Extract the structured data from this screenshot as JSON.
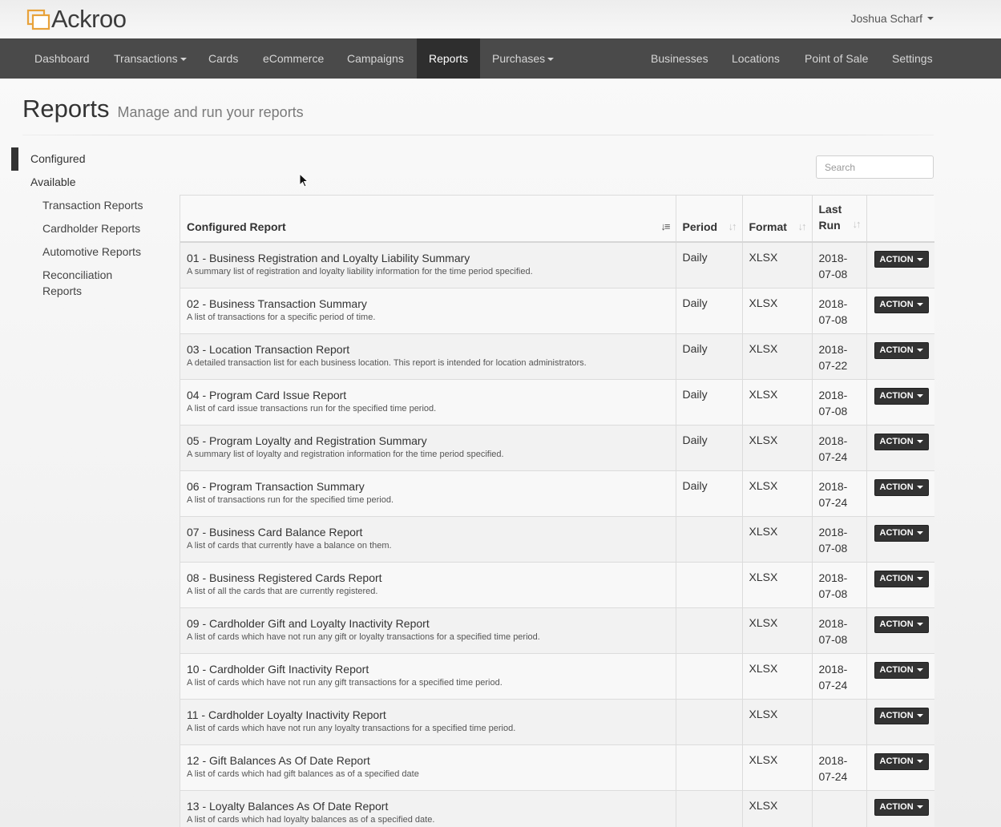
{
  "brand": {
    "name": "Ackroo"
  },
  "user": {
    "name": "Joshua Scharf"
  },
  "nav": {
    "left": [
      {
        "label": "Dashboard",
        "dropdown": false
      },
      {
        "label": "Transactions",
        "dropdown": true
      },
      {
        "label": "Cards",
        "dropdown": false
      },
      {
        "label": "eCommerce",
        "dropdown": false
      },
      {
        "label": "Campaigns",
        "dropdown": false
      },
      {
        "label": "Reports",
        "dropdown": false,
        "active": true
      },
      {
        "label": "Purchases",
        "dropdown": true
      }
    ],
    "right": [
      {
        "label": "Businesses"
      },
      {
        "label": "Locations"
      },
      {
        "label": "Point of Sale"
      },
      {
        "label": "Settings"
      }
    ]
  },
  "page": {
    "title": "Reports",
    "subtitle": "Manage and run your reports"
  },
  "sidebar": {
    "configured": "Configured",
    "available": "Available",
    "sub": [
      "Transaction Reports",
      "Cardholder Reports",
      "Automotive Reports",
      "Reconciliation",
      "Reports"
    ]
  },
  "search": {
    "placeholder": "Search"
  },
  "table": {
    "headers": {
      "report": "Configured Report",
      "period": "Period",
      "format": "Format",
      "last_run_1": "Last",
      "last_run_2": "Run"
    },
    "action_label": "ACTION",
    "rows": [
      {
        "name": "01 - Business Registration and Loyalty Liability Summary",
        "desc": "A summary list of registration and loyalty liability information for the time period specified.",
        "period": "Daily",
        "format": "XLSX",
        "last_run_1": "2018-",
        "last_run_2": "07-08"
      },
      {
        "name": "02 - Business Transaction Summary",
        "desc": "A list of transactions for a specific period of time.",
        "period": "Daily",
        "format": "XLSX",
        "last_run_1": "2018-",
        "last_run_2": "07-08"
      },
      {
        "name": "03 - Location Transaction Report",
        "desc": "A detailed transaction list for each business location. This report is intended for location administrators.",
        "period": "Daily",
        "format": "XLSX",
        "last_run_1": "2018-",
        "last_run_2": "07-22"
      },
      {
        "name": "04 - Program Card Issue Report",
        "desc": "A list of card issue transactions run for the specified time period.",
        "period": "Daily",
        "format": "XLSX",
        "last_run_1": "2018-",
        "last_run_2": "07-08"
      },
      {
        "name": "05 - Program Loyalty and Registration Summary",
        "desc": "A summary list of loyalty and registration information for the time period specified.",
        "period": "Daily",
        "format": "XLSX",
        "last_run_1": "2018-",
        "last_run_2": "07-24"
      },
      {
        "name": "06 - Program Transaction Summary",
        "desc": "A list of transactions run for the specified time period.",
        "period": "Daily",
        "format": "XLSX",
        "last_run_1": "2018-",
        "last_run_2": "07-24"
      },
      {
        "name": "07 - Business Card Balance Report",
        "desc": "A list of cards that currently have a balance on them.",
        "period": "",
        "format": "XLSX",
        "last_run_1": "2018-",
        "last_run_2": "07-08"
      },
      {
        "name": "08 - Business Registered Cards Report",
        "desc": "A list of all the cards that are currently registered.",
        "period": "",
        "format": "XLSX",
        "last_run_1": "2018-",
        "last_run_2": "07-08"
      },
      {
        "name": "09 - Cardholder Gift and Loyalty Inactivity Report",
        "desc": "A list of cards which have not run any gift or loyalty transactions for a specified time period.",
        "period": "",
        "format": "XLSX",
        "last_run_1": "2018-",
        "last_run_2": "07-08"
      },
      {
        "name": "10 - Cardholder Gift Inactivity Report",
        "desc": "A list of cards which have not run any gift transactions for a specified time period.",
        "period": "",
        "format": "XLSX",
        "last_run_1": "2018-",
        "last_run_2": "07-24"
      },
      {
        "name": "11 - Cardholder Loyalty Inactivity Report",
        "desc": "A list of cards which have not run any loyalty transactions for a specified time period.",
        "period": "",
        "format": "XLSX",
        "last_run_1": "",
        "last_run_2": ""
      },
      {
        "name": "12 - Gift Balances As Of Date Report",
        "desc": "A list of cards which had gift balances as of a specified date",
        "period": "",
        "format": "XLSX",
        "last_run_1": "2018-",
        "last_run_2": "07-24"
      },
      {
        "name": "13 - Loyalty Balances As Of Date Report",
        "desc": "A list of cards which had loyalty balances as of a specified date.",
        "period": "",
        "format": "XLSX",
        "last_run_1": "",
        "last_run_2": ""
      }
    ]
  },
  "colors": {
    "navbar": "#4a4a4a",
    "nav_active": "#2e2e2e",
    "logo_accent": "#e8a23a",
    "action_button": "#333333"
  }
}
